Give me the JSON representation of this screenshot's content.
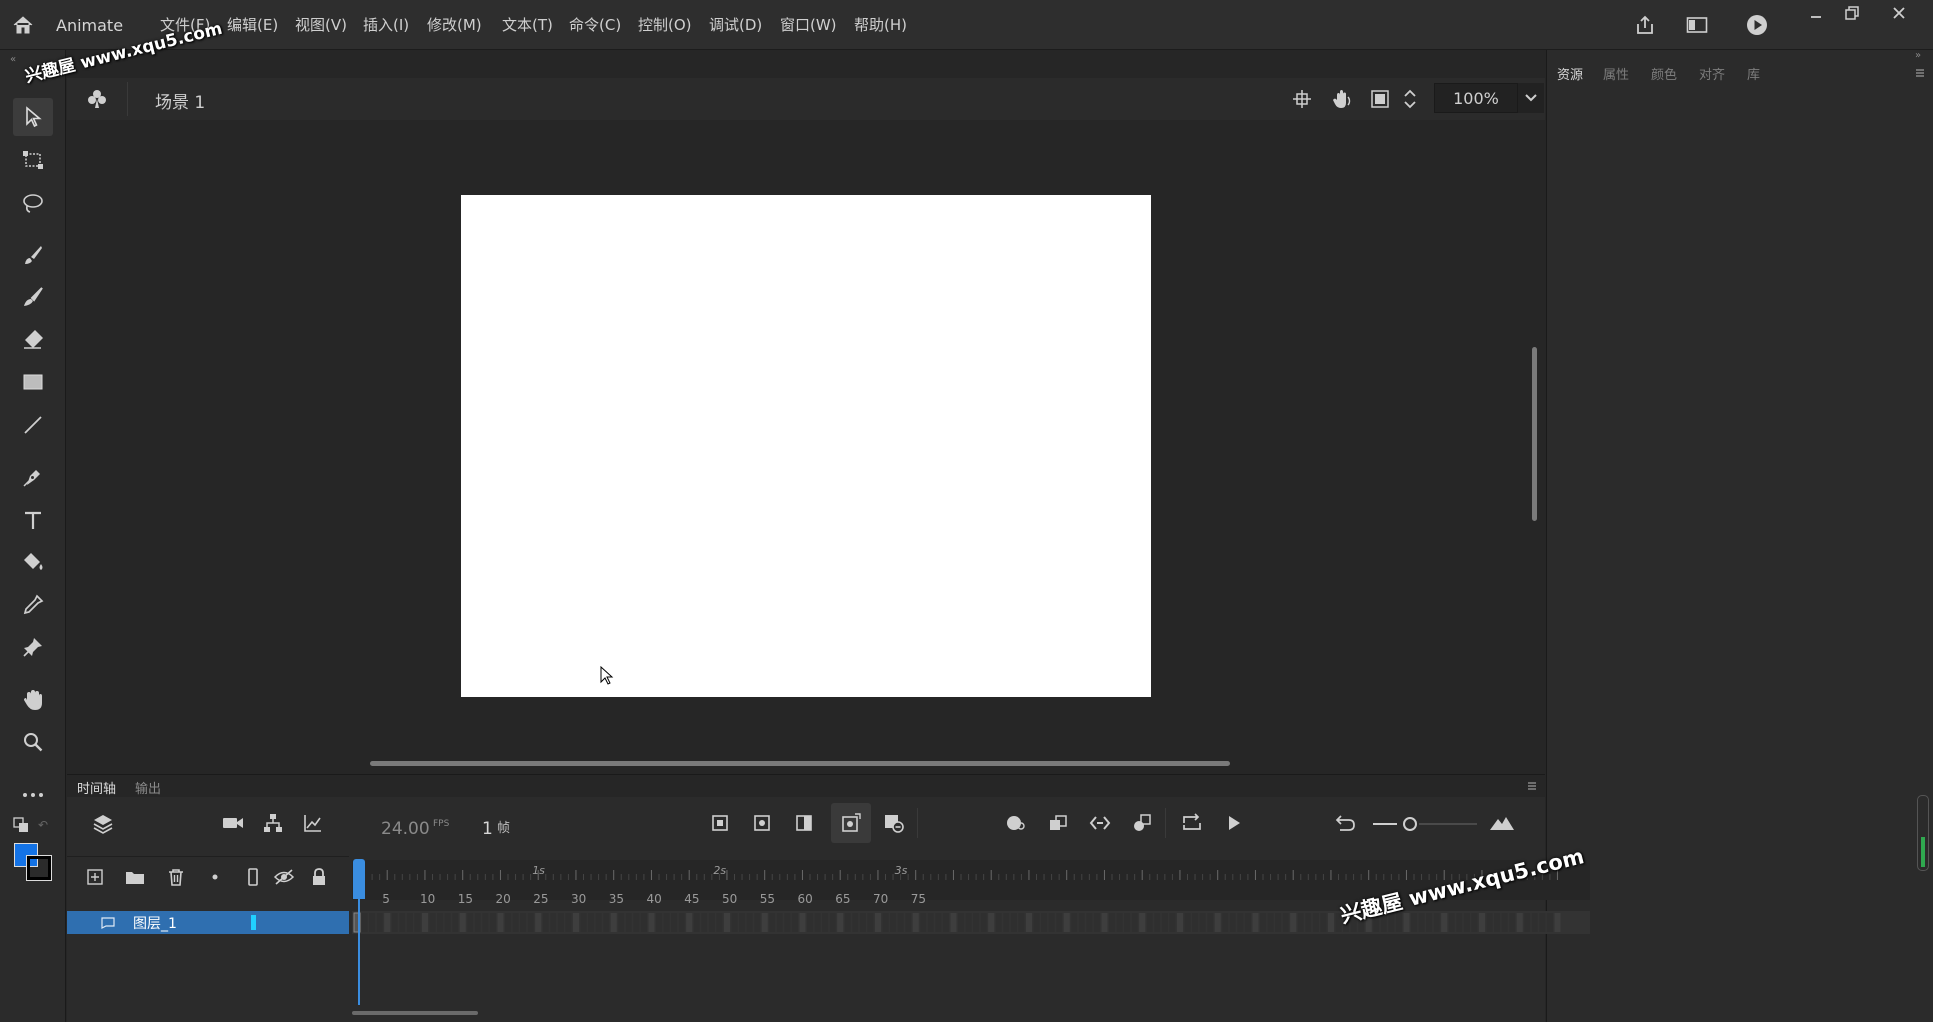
{
  "app": {
    "name": "Animate"
  },
  "menu": [
    "文件(F)",
    "编辑(E)",
    "视图(V)",
    "插入(I)",
    "修改(M)",
    "文本(T)",
    "命令(C)",
    "控制(O)",
    "调试(D)",
    "窗口(W)",
    "帮助(H)"
  ],
  "stage": {
    "scene": "场景 1",
    "zoom": "100%"
  },
  "right_panel": {
    "tabs": [
      "资源",
      "属性",
      "颜色",
      "对齐",
      "库"
    ]
  },
  "timeline": {
    "tabs": [
      "时间轴",
      "输出"
    ],
    "fps": "24.00",
    "fps_unit": "FPS",
    "frame": "1",
    "frame_unit": "帧",
    "layer_name": "图层_1",
    "frame_ticks": [
      "5",
      "10",
      "15",
      "20",
      "25",
      "30",
      "35",
      "40",
      "45",
      "50",
      "55",
      "60",
      "65",
      "70",
      "75"
    ],
    "second_marks": [
      "1s",
      "2s",
      "3s"
    ]
  },
  "colors": {
    "fill": "#1473e6",
    "stroke": "#000000",
    "accent": "#3a8de0"
  },
  "watermark": {
    "text": "兴趣屋 www.xqu5.com"
  }
}
